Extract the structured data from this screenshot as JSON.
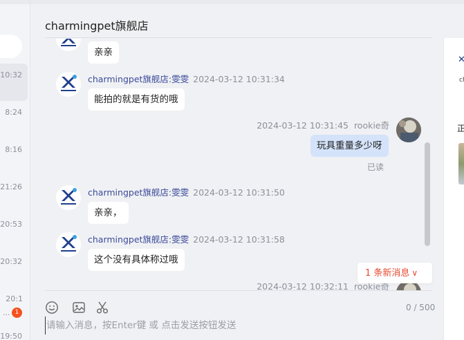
{
  "header": {
    "title": "charmingpet旗舰店"
  },
  "conversation_list": {
    "times": [
      "10:32",
      "8:24",
      "8:16",
      "21:26",
      "20:53",
      "20:32",
      "20:1",
      "19:50"
    ],
    "unread_badge": "1",
    "ellipsis": "..."
  },
  "messages": [
    {
      "side": "shop",
      "text": "亲亲"
    },
    {
      "side": "shop",
      "sender": "charmingpet旗舰店:雯雯",
      "time": "2024-03-12 10:31:34",
      "text": "能拍的就是有货的哦"
    },
    {
      "side": "me",
      "sender": "rookie奇",
      "time": "2024-03-12 10:31:45",
      "text": "玩具重量多少呀",
      "status": "已读"
    },
    {
      "side": "shop",
      "sender": "charmingpet旗舰店:雯雯",
      "time": "2024-03-12 10:31:50",
      "text": "亲亲，"
    },
    {
      "side": "shop",
      "sender": "charmingpet旗舰店:雯雯",
      "time": "2024-03-12 10:31:58",
      "text": "这个没有具体称过哦"
    },
    {
      "side": "me",
      "sender": "rookie奇",
      "time": "2024-03-12 10:32:11"
    }
  ],
  "new_message_pill": {
    "label": "1 条新消息",
    "chevron": "∨"
  },
  "composer": {
    "placeholder": "请输入消息，按Enter键 或 点击发送按钮发送",
    "counter": "0 / 500",
    "tools": [
      "emoji-icon",
      "image-icon",
      "scissors-icon"
    ]
  },
  "right_panel": {
    "glyph": "正"
  },
  "colors": {
    "accent_red": "#e8492f",
    "sender_blue": "#3b4b9a",
    "my_bubble": "#d4e3fa",
    "badge": "#f4511e"
  }
}
